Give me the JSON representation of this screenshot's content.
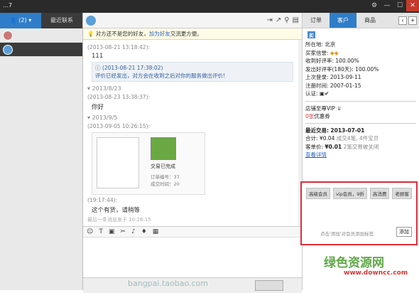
{
  "window": {
    "title": "…7"
  },
  "left": {
    "tab_contacts": "(2)",
    "tab_recent": "最近联系",
    "contacts": [
      {
        "name": "",
        "flag": "",
        "selected": false
      },
      {
        "name": "",
        "flag": "",
        "selected": true
      }
    ]
  },
  "chat": {
    "notice_pre": "对方还不是您的好友，",
    "notice_link": "加为好友",
    "notice_post": "交流更方便。",
    "m1_sender": "(2013-08-21 13:18:42):",
    "m1_text": "111",
    "sys_time": "(2013-08-21 17:38:02)",
    "sys_text": "评价已经发出，对方会在收到之后对你的服务做出评价!",
    "date1": "2013/8/23",
    "m2_sender": "(2013-08-23 13:38:37):",
    "m2_text": "你好",
    "date2": "2013/9/5",
    "m3_sender": "(2013-09-05 10:26:15):",
    "card_t1": "交易已完成",
    "card_t2": "订单编号：37",
    "card_t3": "成交时间：20",
    "m4_sender": "(19:17:44):",
    "m4_text": "这个有货，请稍等",
    "hint": "最后一条消息发于 10:26:15",
    "send_label": ""
  },
  "right": {
    "tabs": [
      "订单",
      "客户",
      "商品"
    ],
    "badge1": "买",
    "badge2": "",
    "lines": [
      "所在地: 北京",
      "买家信誉:",
      "收到好评率: 100.00%",
      "发出好评率(180天): 100.00%",
      "上次登录: 2013-09-11",
      "注册时间: 2007-01-15",
      "认证:"
    ],
    "vip_line1": "店铺至尊VIP",
    "vip_prefix": "0张",
    "vip_suffix": "优惠券",
    "trade_title": "最近交易:",
    "trade_date": "2013-07-01",
    "total_label": "合计:",
    "total_value": "¥0.04",
    "total_meta": "成交4笔, 4件宝贝",
    "unit_label": "客单价:",
    "unit_value": "¥0.01",
    "unit_meta": "2笔交易被关闭",
    "details_link": "查看详情",
    "tags": [
      "高级会员",
      "vip会员，9折",
      "高消费",
      "老顾客"
    ],
    "tag_hint": "点击'添加'对会员添加标签",
    "add_btn": "添加"
  },
  "watermark": {
    "cn": "绿色资源网",
    "url": "www.downcc.com",
    "bottom": "bangpai.taobao.com"
  },
  "colors": {
    "accent": "#2f7dc9",
    "highlight_border": "#d9303a"
  }
}
